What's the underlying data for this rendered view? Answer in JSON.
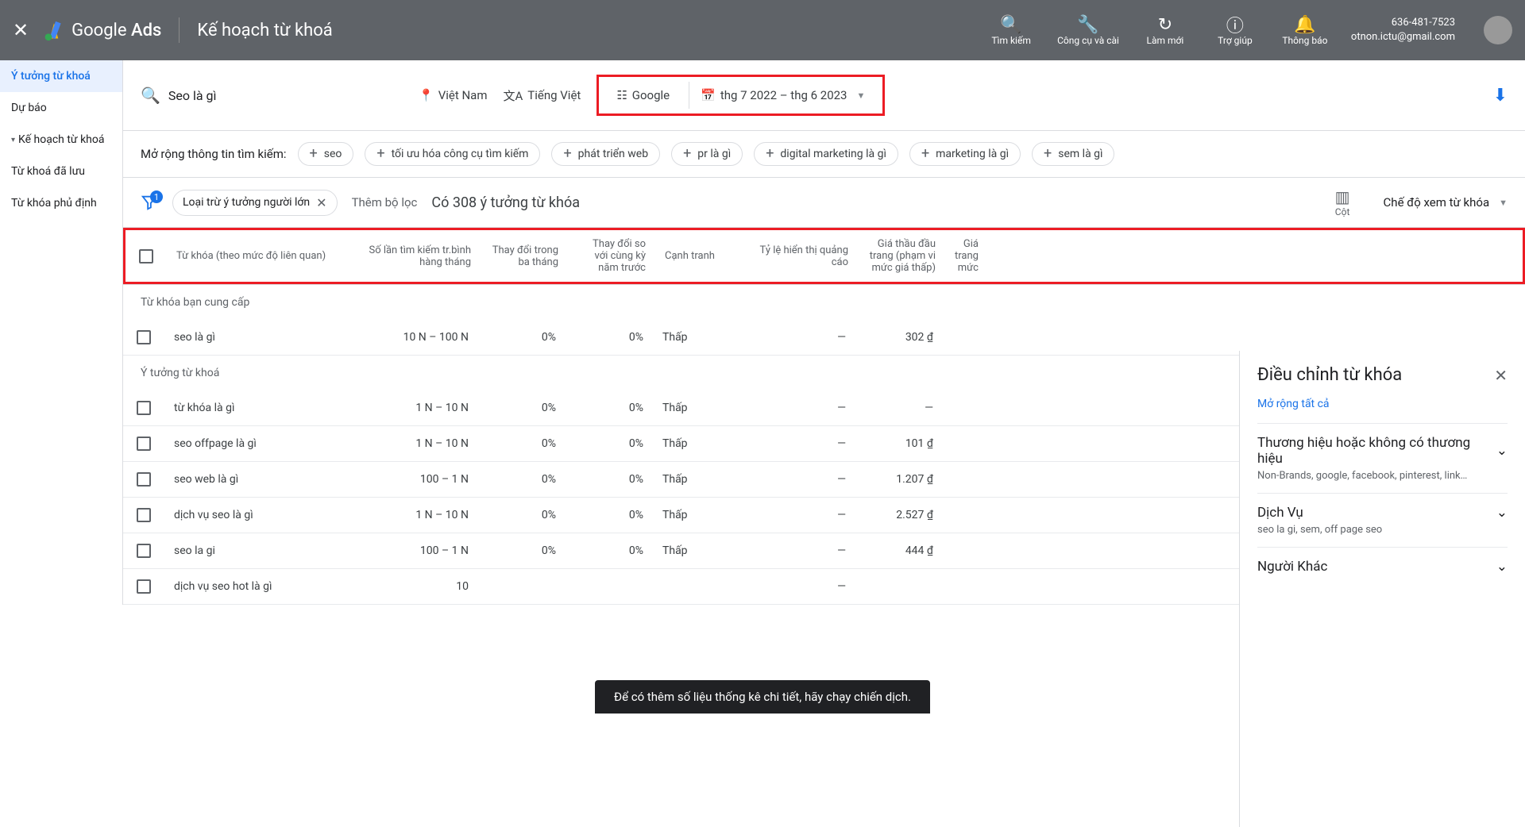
{
  "header": {
    "brand1": "Google",
    "brand2": "Ads",
    "page_title": "Kế hoạch từ khoá",
    "tools": {
      "search": "Tìm kiếm",
      "tools": "Công cụ và cài",
      "refresh": "Làm mới",
      "help": "Trợ giúp",
      "notifications": "Thông báo"
    },
    "account_id": "636-481-7523",
    "account_email": "otnon.ictu@gmail.com"
  },
  "sidebar": {
    "items": [
      {
        "label": "Ý tưởng từ khoá"
      },
      {
        "label": "Dự báo"
      },
      {
        "label": "Kế hoạch từ khoá"
      },
      {
        "label": "Từ khoá đã lưu"
      },
      {
        "label": "Từ khóa phủ định"
      }
    ]
  },
  "controls": {
    "query": "Seo là gì",
    "location": "Việt Nam",
    "language": "Tiếng Việt",
    "network": "Google",
    "date_range": "thg 7 2022 – thg 6 2023"
  },
  "broaden": {
    "label": "Mở rộng thông tin tìm kiếm:",
    "chips": [
      "seo",
      "tối ưu hóa công cụ tìm kiếm",
      "phát triển web",
      "pr là gì",
      "digital marketing là gì",
      "marketing là gì",
      "sem là gì"
    ]
  },
  "filters": {
    "badge": "1",
    "exclude_chip": "Loại trừ ý tưởng người lớn",
    "add_filter": "Thêm bộ lọc",
    "ideas_count": "Có 308 ý tưởng từ khóa",
    "columns_label": "Cột",
    "view_mode": "Chế độ xem từ khóa"
  },
  "columns": {
    "kw": "Từ khóa (theo mức độ liên quan)",
    "avg": "Số lần tìm kiếm tr.bình hàng tháng",
    "c3m": "Thay đổi trong ba tháng",
    "yoy": "Thay đổi so với cùng kỳ năm trước",
    "comp": "Cạnh tranh",
    "impr": "Tỷ lệ hiển thị quảng cáo",
    "bid_low": "Giá thầu đầu trang (phạm vi mức giá thấp)",
    "bid_high_frag": "Giá trang mức"
  },
  "sections": {
    "provided": "Từ khóa bạn cung cấp",
    "ideas": "Ý tưởng từ khoá"
  },
  "rows_provided": [
    {
      "kw": "seo là gì",
      "avg": "10 N – 100 N",
      "c3m": "0%",
      "yoy": "0%",
      "comp": "Thấp",
      "impr": "—",
      "bid": "302 ₫"
    }
  ],
  "rows_ideas": [
    {
      "kw": "từ khóa là gì",
      "avg": "1 N – 10 N",
      "c3m": "0%",
      "yoy": "0%",
      "comp": "Thấp",
      "impr": "—",
      "bid": "—"
    },
    {
      "kw": "seo offpage là gì",
      "avg": "1 N – 10 N",
      "c3m": "0%",
      "yoy": "0%",
      "comp": "Thấp",
      "impr": "—",
      "bid": "101 ₫"
    },
    {
      "kw": "seo web là gì",
      "avg": "100 – 1 N",
      "c3m": "0%",
      "yoy": "0%",
      "comp": "Thấp",
      "impr": "—",
      "bid": "1.207 ₫"
    },
    {
      "kw": "dịch vụ seo là gì",
      "avg": "1 N – 10 N",
      "c3m": "0%",
      "yoy": "0%",
      "comp": "Thấp",
      "impr": "—",
      "bid": "2.527 ₫"
    },
    {
      "kw": "seo la gi",
      "avg": "100 – 1 N",
      "c3m": "0%",
      "yoy": "0%",
      "comp": "Thấp",
      "impr": "—",
      "bid": "444 ₫"
    },
    {
      "kw": "dịch vụ seo hot là gì",
      "avg": "10",
      "c3m": "",
      "yoy": "",
      "comp": "",
      "impr": "—",
      "bid": ""
    }
  ],
  "right_panel": {
    "title": "Điều chỉnh từ khóa",
    "expand_all": "Mở rộng tất cả",
    "sections": [
      {
        "title": "Thương hiệu hoặc không có thương hiệu",
        "sub": "Non-Brands, google, facebook, pinterest, link…"
      },
      {
        "title": "Dịch Vụ",
        "sub": "seo la gi, sem, off page seo"
      },
      {
        "title": "Người Khác",
        "sub": ""
      }
    ]
  },
  "toast": "Để có thêm số liệu thống kê chi tiết, hãy chạy chiến dịch."
}
